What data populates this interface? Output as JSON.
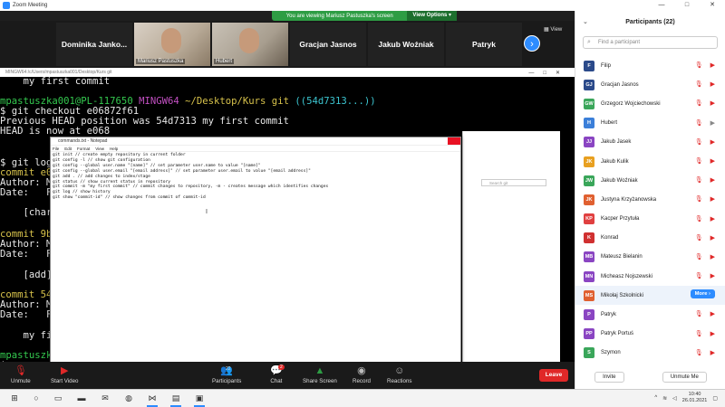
{
  "window": {
    "title": "Zoom Meeting",
    "controls": [
      "—",
      "□",
      "✕"
    ]
  },
  "share_banner": {
    "text": "You are viewing Mariusz Pastuszka's screen",
    "view_options": "View Options ▾"
  },
  "gallery": {
    "tiles": [
      {
        "name": "Dominika Janko..."
      },
      {
        "name": "Mariusz Pastuszka"
      },
      {
        "name": "Hubert"
      },
      {
        "name": "Gracjan Jasnos"
      },
      {
        "name": "Jakub Woźniak"
      },
      {
        "name": "Patryk"
      }
    ],
    "view_label": "View"
  },
  "terminal": {
    "titlebar": "MINGW64:/c/Users/mpastuszka001/Desktop/Kurs git",
    "lines": {
      "l1": "    my first commit",
      "l2_user": "mpastuszka001@PL-117650",
      "l2_env": "MINGW64",
      "l2_path": "~/Desktop/Kurs git",
      "l2_branch": "((54d7313...))",
      "l3": "$ git checkout e06872f61",
      "l4": "Previous HEAD position was 54d7313 my first commit",
      "l5": "HEAD is now at e068",
      "l6": "$ git log",
      "l7": "commit e0",
      "l8": "Author: M",
      "l9": "Date:   F",
      "l10": "    [char",
      "l11": "commit 9b",
      "l12": "Author: M",
      "l13": "Date:   F",
      "l14": "    [add]",
      "l15": "commit 54",
      "l16": "Author: M",
      "l17": "Date:   F",
      "l18": "    my fi",
      "l19": "mpastuszk",
      "l20": "$"
    }
  },
  "notepad": {
    "title": "commands.txt - Notepad",
    "menu": [
      "File",
      "Edit",
      "Format",
      "View",
      "Help"
    ],
    "lines": [
      "git init // create empty repository in current folder",
      "git config -l // show git configuration",
      "git config --global user.name \"[name]\" // set parameter user.name to value \"[name]\"",
      "git config --global user.email \"[email address]\" // set parameter user.email to value \"[email address]\"",
      "git add . // add changes to index/stage",
      "git status // show current status in repository",
      "git commit -m \"my first commit\" // commit changes to repository, -m - creates message which identifies changes",
      "git log // show history",
      "git show \"commit-id\" // show changes from commit of commit-id"
    ]
  },
  "bg_window": {
    "search_placeholder": "Search git"
  },
  "toolbar": {
    "unmute": "Unmute",
    "start_video": "Start Video",
    "participants": "Participants",
    "participants_count": "22",
    "chat": "Chat",
    "chat_badge": "2",
    "share_screen": "Share Screen",
    "record": "Record",
    "reactions": "Reactions",
    "leave": "Leave"
  },
  "panel": {
    "title": "Participants (22)",
    "search_placeholder": "Find a participant",
    "invite": "Invite",
    "unmute_me": "Unmute Me",
    "more": "More ›",
    "participants": [
      {
        "initials": "F",
        "name": "Filip",
        "color": "#2b4a8a"
      },
      {
        "initials": "GJ",
        "name": "Gracjan Jasnos",
        "color": "#2b4a8a"
      },
      {
        "initials": "GW",
        "name": "Grzegorz Wojciechowski",
        "color": "#3aa65a"
      },
      {
        "initials": "H",
        "name": "Hubert",
        "color": "#3b7fd9"
      },
      {
        "initials": "JJ",
        "name": "Jakub Jasek",
        "color": "#8a45c2"
      },
      {
        "initials": "JK",
        "name": "Jakub Kulik",
        "color": "#e8a020"
      },
      {
        "initials": "JW",
        "name": "Jakub Woźniak",
        "color": "#3aa65a"
      },
      {
        "initials": "JK",
        "name": "Justyna Krzyżanowska",
        "color": "#e06030"
      },
      {
        "initials": "KP",
        "name": "Kacper Przytuła",
        "color": "#e04040"
      },
      {
        "initials": "K",
        "name": "Konrad",
        "color": "#d03030"
      },
      {
        "initials": "MB",
        "name": "Mateusz Bielanin",
        "color": "#8a45c2"
      },
      {
        "initials": "MN",
        "name": "Micheasz Nojszewski",
        "color": "#8a45c2"
      },
      {
        "initials": "MS",
        "name": "Mikołaj Szkolnicki",
        "color": "#e06030"
      },
      {
        "initials": "P",
        "name": "Patryk",
        "color": "#8a45c2"
      },
      {
        "initials": "PP",
        "name": "Patryk Portuś",
        "color": "#8a45c2"
      },
      {
        "initials": "S",
        "name": "Szymon",
        "color": "#3aa65a"
      }
    ]
  },
  "taskbar": {
    "time": "10:40",
    "date": "26.01.2021"
  }
}
